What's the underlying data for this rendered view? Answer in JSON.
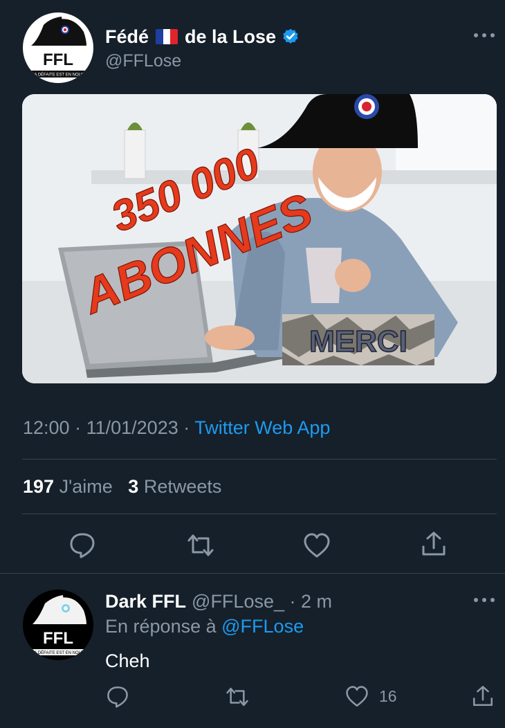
{
  "tweet": {
    "display_name_part1": "Fédé",
    "display_name_part2": "de la Lose",
    "flag_colors": [
      "#1f3fa0",
      "#ffffff",
      "#e0242c"
    ],
    "handle": "@FFLose",
    "verified_icon": "verified-badge-icon",
    "avatar_text": "FFL",
    "avatar_motto": "LA DÉFAITE EST EN NOUS",
    "media": {
      "headline_number": "350 000",
      "headline_word": "ABONNES",
      "sign_text": "MERCI"
    },
    "time": "12:00",
    "date": "11/01/2023",
    "source": "Twitter Web App",
    "likes_count": "197",
    "likes_label": "J'aime",
    "retweets_count": "3",
    "retweets_label": "Retweets",
    "actions": [
      "reply-icon",
      "retweet-icon",
      "like-icon",
      "share-icon"
    ]
  },
  "reply": {
    "display_name": "Dark FFL",
    "handle": "@FFLose_",
    "age": "2 m",
    "in_reply_prefix": "En réponse à",
    "in_reply_mention": "@FFLose",
    "text": "Cheh",
    "avatar_text": "FFL",
    "avatar_motto": "LA DÉFAITE EST EN NOUS",
    "like_count": "16"
  },
  "colors": {
    "background": "#15202b",
    "accent": "#1d9bf0",
    "muted": "#8b98a5",
    "divider": "#38444d"
  }
}
